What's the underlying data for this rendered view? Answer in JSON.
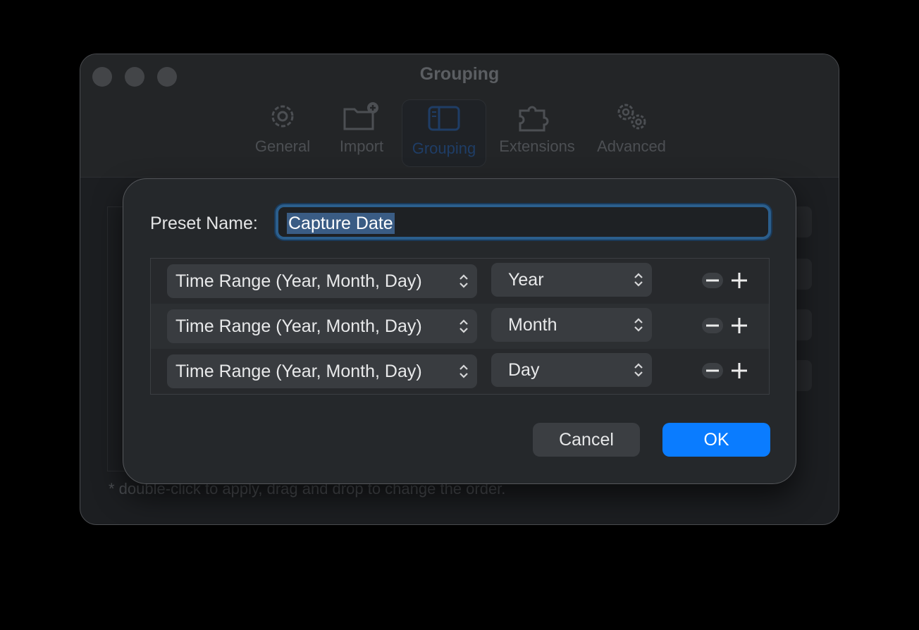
{
  "window": {
    "title": "Grouping"
  },
  "tabs": [
    {
      "label": "General",
      "icon": "gear-icon"
    },
    {
      "label": "Import",
      "icon": "folder-add-icon"
    },
    {
      "label": "Grouping",
      "icon": "sidebar-icon",
      "selected": true
    },
    {
      "label": "Extensions",
      "icon": "puzzle-icon"
    },
    {
      "label": "Advanced",
      "icon": "gears-icon"
    }
  ],
  "footnote": "* double-click to apply, drag and drop to change the order.",
  "sheet": {
    "preset_label": "Preset Name:",
    "preset_value": "Capture Date",
    "rows": [
      {
        "field": "Time Range (Year, Month, Day)",
        "unit": "Year"
      },
      {
        "field": "Time Range (Year, Month, Day)",
        "unit": "Month"
      },
      {
        "field": "Time Range (Year, Month, Day)",
        "unit": "Day"
      }
    ],
    "cancel_label": "Cancel",
    "ok_label": "OK"
  },
  "colors": {
    "accent": "#0a7cff",
    "focus_ring": "#2b5e8c",
    "selection": "#3a5c84"
  }
}
